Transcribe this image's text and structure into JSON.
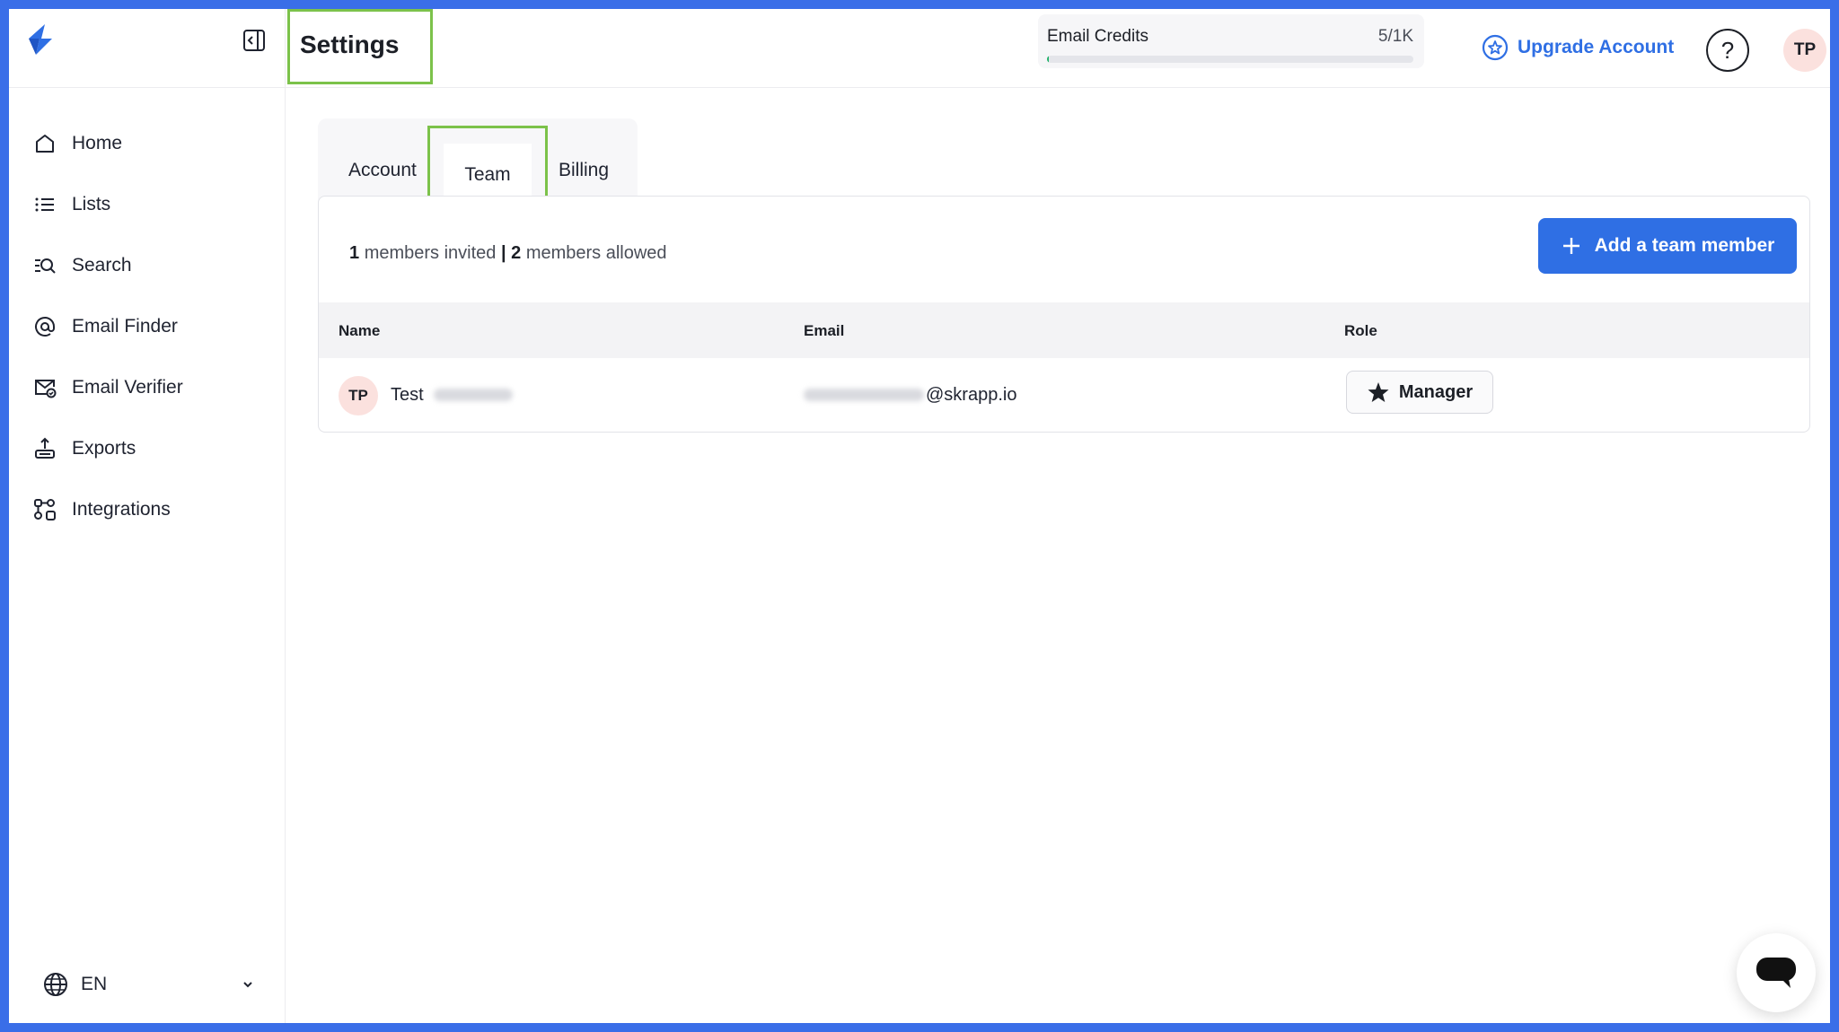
{
  "header": {
    "title": "Settings",
    "credits_label": "Email Credits",
    "credits_count": "5/1K",
    "credits_fraction": 0.005,
    "upgrade_label": "Upgrade Account",
    "help_label": "?",
    "user_initials": "TP"
  },
  "sidebar": {
    "items": [
      {
        "label": "Home",
        "icon": "home-icon"
      },
      {
        "label": "Lists",
        "icon": "list-icon"
      },
      {
        "label": "Search",
        "icon": "search-icon"
      },
      {
        "label": "Email Finder",
        "icon": "at-icon"
      },
      {
        "label": "Email Verifier",
        "icon": "mail-check-icon"
      },
      {
        "label": "Exports",
        "icon": "export-icon"
      },
      {
        "label": "Integrations",
        "icon": "integrations-icon"
      }
    ],
    "language": "EN"
  },
  "tabs": [
    {
      "label": "Account",
      "active": false
    },
    {
      "label": "Team",
      "active": true
    },
    {
      "label": "Billing",
      "active": false
    }
  ],
  "team": {
    "invited_count": "1",
    "invited_text": "members invited",
    "separator": "|",
    "allowed_count": "2",
    "allowed_text": "members allowed",
    "add_button_label": "Add a team member",
    "columns": {
      "name": "Name",
      "email": "Email",
      "role": "Role"
    },
    "members": [
      {
        "initials": "TP",
        "name_visible": "Test",
        "email_domain": "@skrapp.io",
        "role": "Manager"
      }
    ]
  },
  "colors": {
    "primary": "#2f6fe4",
    "highlight": "#7cc24a",
    "avatar_bg": "#fbe1de",
    "credit_bar": "#23b26b"
  }
}
